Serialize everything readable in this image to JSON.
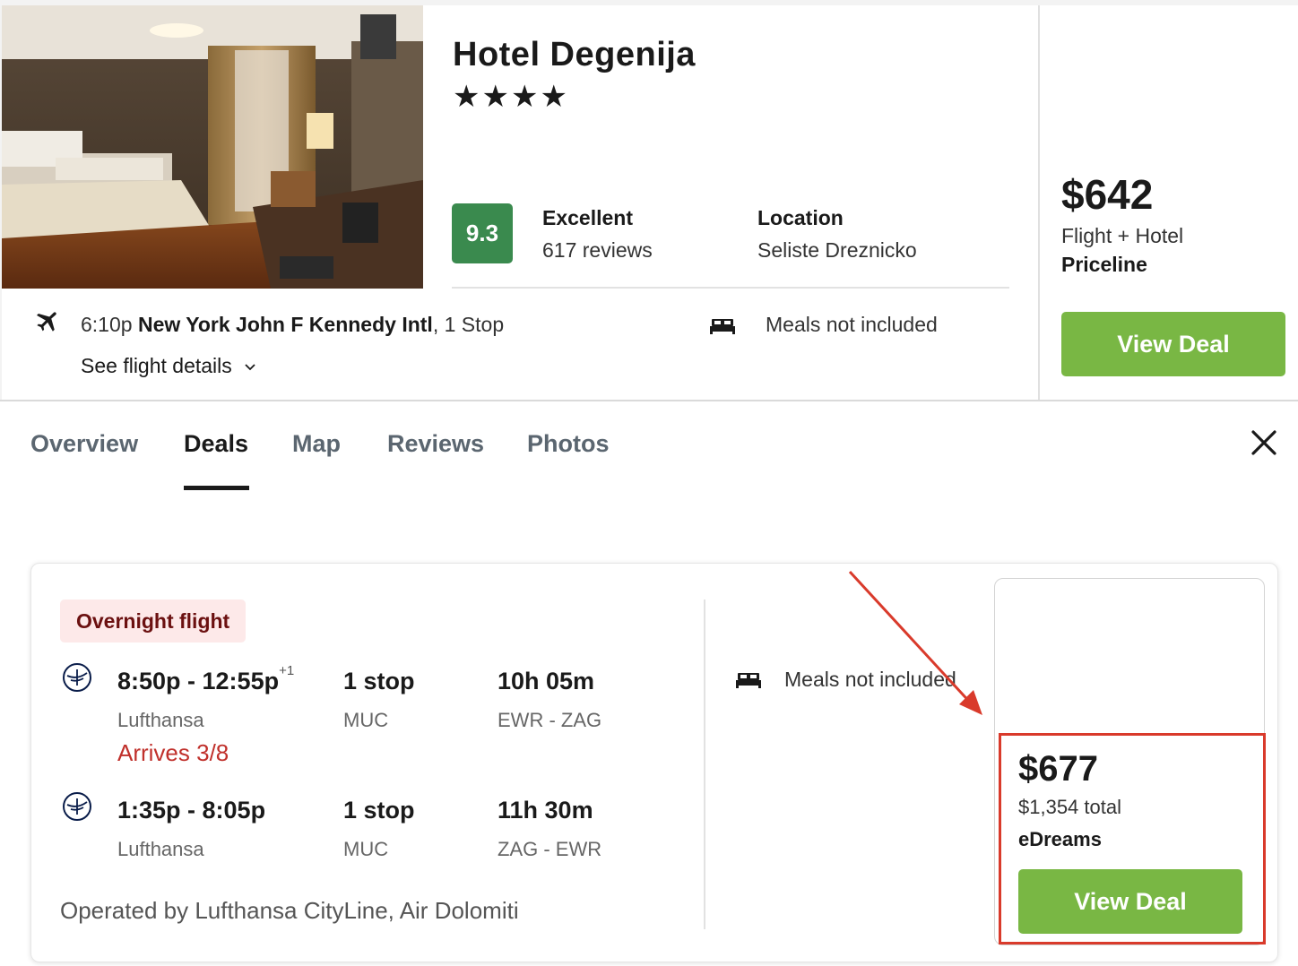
{
  "hotel": {
    "name": "Hotel Degenija",
    "stars": "★★★★",
    "score": "9.3",
    "rating_word": "Excellent",
    "review_count": "617 reviews",
    "location_label": "Location",
    "location_value": "Seliste Dreznicko"
  },
  "flight_summary": {
    "time": "6:10p",
    "airport": "New York John F Kennedy Intl",
    "stops": ", 1 Stop",
    "details_link": "See flight details",
    "meals": "Meals not included"
  },
  "price_panel": {
    "price": "$642",
    "type": "Flight + Hotel",
    "provider": "Priceline",
    "button": "View Deal"
  },
  "tabs": [
    {
      "label": "Overview"
    },
    {
      "label": "Deals"
    },
    {
      "label": "Map"
    },
    {
      "label": "Reviews"
    },
    {
      "label": "Photos"
    }
  ],
  "active_tab": "Deals",
  "deal": {
    "badge": "Overnight flight",
    "legs": [
      {
        "times": "8:50p - 12:55p",
        "plus_day": "+1",
        "airline": "Lufthansa",
        "stops": "1 stop",
        "stop_airport": "MUC",
        "duration": "10h 05m",
        "route": "EWR - ZAG",
        "arrives": "Arrives 3/8"
      },
      {
        "times": "1:35p - 8:05p",
        "airline": "Lufthansa",
        "stops": "1 stop",
        "stop_airport": "MUC",
        "duration": "11h 30m",
        "route": "ZAG - EWR"
      }
    ],
    "operated_by": "Operated by Lufthansa CityLine, Air Dolomiti",
    "meals": "Meals not included",
    "price": "$677",
    "total": "$1,354 total",
    "provider": "eDreams",
    "button": "View Deal"
  },
  "colors": {
    "score_badge": "#3a8a4e",
    "view_deal": "#79b744",
    "annotation": "#d93a2b",
    "arrives": "#c0302b"
  }
}
